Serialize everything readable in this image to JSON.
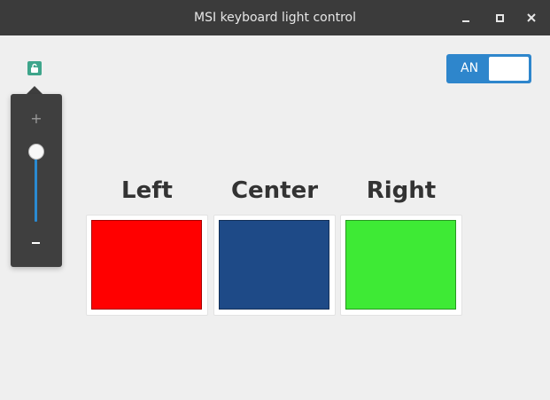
{
  "window": {
    "title": "MSI keyboard light control",
    "controls": [
      "minimize",
      "maximize",
      "close"
    ]
  },
  "brightness": {
    "icon": "brightness-icon",
    "plus_label": "+",
    "level": 0.9
  },
  "power_toggle": {
    "label": "AN",
    "state": "on",
    "color": "#2e86cc"
  },
  "zones": [
    {
      "label": "Left",
      "color": "#ff0000"
    },
    {
      "label": "Center",
      "color": "#1e4a87"
    },
    {
      "label": "Right",
      "color": "#3eea35"
    }
  ]
}
